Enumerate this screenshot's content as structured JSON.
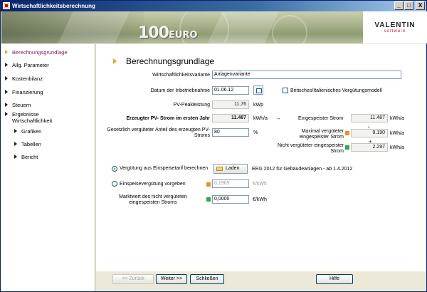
{
  "window": {
    "title": "Wirtschaftlichkeitsberechnung",
    "buttons": [
      "_",
      "□",
      "X"
    ]
  },
  "banner": {
    "note_value": "100",
    "note_currency": "EURO"
  },
  "logo": {
    "brand": "VALENTIN",
    "sub": "software",
    "accent": "#c8102e"
  },
  "sidebar": {
    "items": [
      {
        "label": "Berechnungsgrundlage",
        "active": true
      },
      {
        "label": "Allg. Parameter"
      },
      {
        "label": "Kostenbilanz"
      },
      {
        "label": "Finanzierung"
      },
      {
        "label": "Steuern"
      },
      {
        "label": "Ergebnisse Wirtschaftlichkeit"
      },
      {
        "label": "Grafiken"
      },
      {
        "label": "Tabellen"
      },
      {
        "label": "Bericht"
      }
    ]
  },
  "main": {
    "title": "Berechnungsgrundlage",
    "variant": {
      "label": "Wirtschaftlichkeitsvariante",
      "value": "Anlagenvariante"
    },
    "start_date": {
      "label": "Datum der Inbetriebnahme",
      "value": "01.06.12"
    },
    "british_model": {
      "label": "Britisches/Italienisches Vergütungsmodell",
      "checked": false
    },
    "pv_peak": {
      "label": "PV-Peakleistung",
      "value": "11,76",
      "unit": "kWp"
    },
    "pv_generated": {
      "label": "Erzeugter PV- Strom im ersten Jahr",
      "value": "11.487",
      "unit": "kWh/a"
    },
    "share": {
      "label": "Gesetzlich vergüteter Anteil des erzeugten PV-Stroms",
      "value": "80",
      "unit": "%"
    },
    "fed_in": {
      "label": "Eingespeister Strom",
      "value": "11.487",
      "unit": "kWh/a"
    },
    "max_paid": {
      "label": "Maximal vergüteter eingespeister Strom",
      "value": "9.190",
      "unit": "kWh/a",
      "color": "#e8902a"
    },
    "not_paid": {
      "label": "Nicht vergüteter eingespeister Strom",
      "value": "2.297",
      "unit": "kWh/a",
      "color": "#2ca84a"
    },
    "arrow_right": "→",
    "arrow_down": "↓",
    "plus": "+",
    "tariff_option": {
      "label": "Vergütung aus Einspeisetarif berechnen",
      "selected": true
    },
    "load_button": "Laden",
    "tariff_name": "EEG 2012 für Gebäudeanlagen - ab 1.4.2012",
    "manual_option": {
      "label": "Einspeisevergütung vorgeben",
      "selected": false,
      "value": "0,1905",
      "unit": "€/kWh"
    },
    "market_value": {
      "label": "Marktwert des nicht vergüteten eingespeisten Stroms",
      "value": "0,0000",
      "unit": "€/kWh"
    }
  },
  "footer": {
    "back": "<< Zurück",
    "next": "Weiter >>",
    "close": "Schließen",
    "help": "Hilfe"
  }
}
